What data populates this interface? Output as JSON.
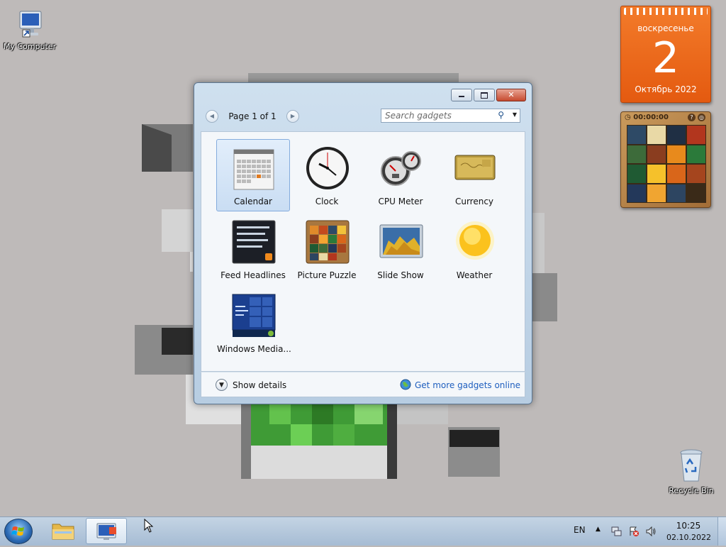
{
  "desktop": {
    "icons": [
      {
        "label": "My Computer"
      },
      {
        "label": "Recycle Bin"
      }
    ]
  },
  "calendar_gadget": {
    "day_name": "воскресенье",
    "day_number": "2",
    "month_year": "Октябрь 2022"
  },
  "puzzle_gadget": {
    "timer": "00:00:00"
  },
  "gadget_window": {
    "page_label": "Page 1 of 1",
    "search_placeholder": "Search gadgets",
    "gadgets": [
      {
        "name": "Calendar",
        "selected": true
      },
      {
        "name": "Clock"
      },
      {
        "name": "CPU Meter"
      },
      {
        "name": "Currency"
      },
      {
        "name": "Feed Headlines"
      },
      {
        "name": "Picture Puzzle"
      },
      {
        "name": "Slide Show"
      },
      {
        "name": "Weather"
      },
      {
        "name": "Windows Media..."
      }
    ],
    "show_details_label": "Show details",
    "more_gadgets_label": "Get more gadgets online"
  },
  "taskbar": {
    "language": "EN",
    "time": "10:25",
    "date": "02.10.2022"
  },
  "colors": {
    "accent": "#1f5fbf",
    "calendar_orange": "#e45a10",
    "taskbar": "#b7cadd"
  }
}
